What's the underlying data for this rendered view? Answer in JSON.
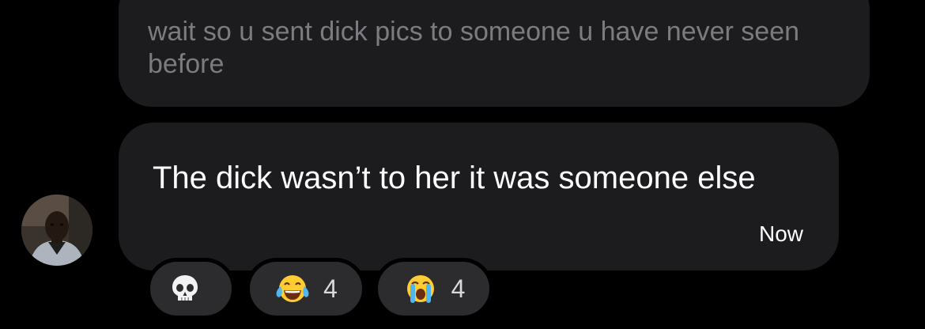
{
  "quoted_message": {
    "text": "wait so u sent dick pics to someone u have never seen before"
  },
  "message": {
    "text": "The dick wasn’t to her it was someone else",
    "timestamp": "Now"
  },
  "reactions": [
    {
      "emoji": "skull-emoji",
      "count": ""
    },
    {
      "emoji": "tears-of-joy-emoji",
      "count": "4"
    },
    {
      "emoji": "loudly-crying-emoji",
      "count": "4"
    }
  ],
  "colors": {
    "background": "#000000",
    "bubble": "#1c1c1e",
    "quoted_text": "#7b7b80",
    "reaction_chip": "#2c2c2e"
  }
}
